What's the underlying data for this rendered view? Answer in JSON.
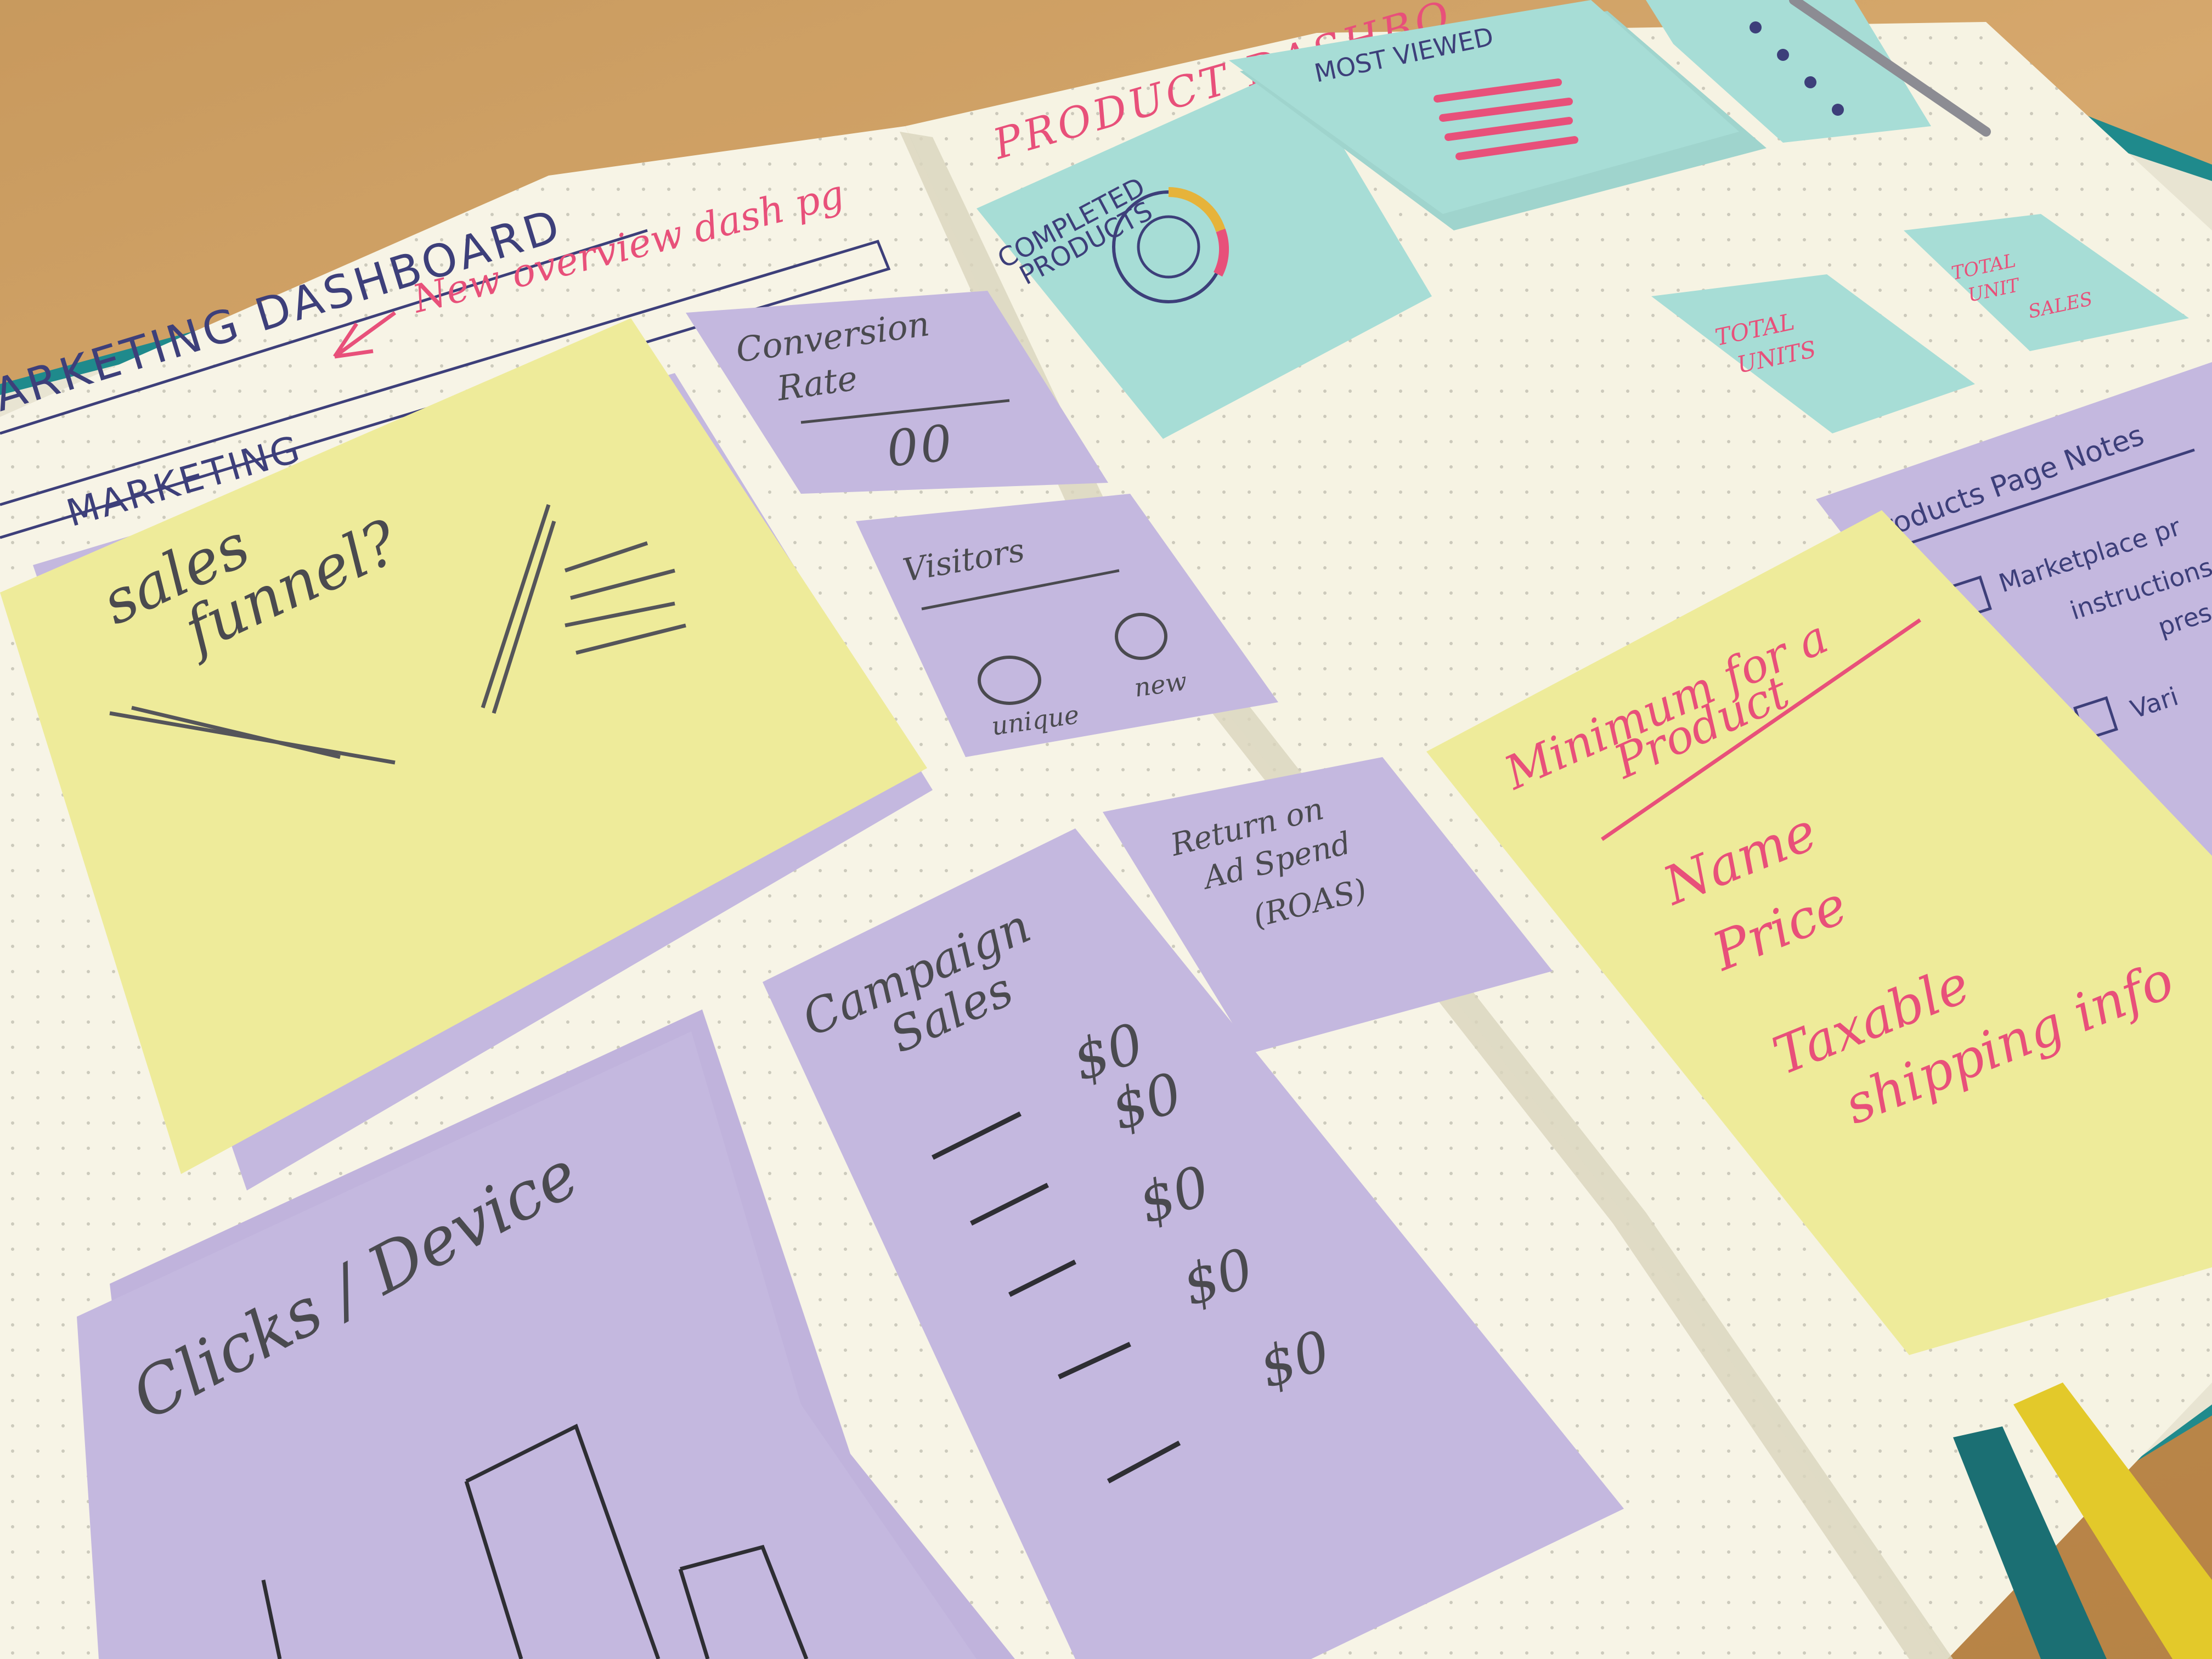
{
  "notebook": {
    "left_page": {
      "heading_title": "ARKETING DASHBOARD",
      "heading_annotation": "New overview dash pg",
      "heading_sub": "MARKETING"
    },
    "right_page": {
      "heading_title": "PRODUCT DASHBO"
    }
  },
  "notes": {
    "sales_funnel": {
      "title_line1": "sales",
      "title_line2": "funnel?"
    },
    "conversion_rate": {
      "title_line1": "Conversion",
      "title_line2": "Rate",
      "value": "00"
    },
    "visitors": {
      "title": "Visitors",
      "label_unique": "unique",
      "label_new": "new"
    },
    "return_on_ad_spend": {
      "line1": "Return on",
      "line2": "Ad Spend",
      "line3": "(ROAS)"
    },
    "campaign_sales": {
      "title_line1": "Campaign",
      "title_line2": "Sales",
      "values": [
        "$0",
        "$0",
        "$0",
        "$0",
        "$0"
      ]
    },
    "clicks_device": {
      "title": "Clicks / Device"
    },
    "completed_products": {
      "title_line1": "COMPLETED",
      "title_line2": "PRODUCTS"
    },
    "most_viewed": {
      "title": "MOST VIEWED"
    },
    "total_units": {
      "title_line1": "TOTAL",
      "title_line2": "UNITS"
    },
    "total_unit_sales": {
      "title_line1": "TOTAL",
      "title_line2": "UNIT",
      "title_line3": "SALES"
    },
    "minimum_product": {
      "title_line1": "Minimum for a",
      "title_line2": "Product",
      "items": [
        "Name",
        "Price",
        "Taxable",
        "shipping info"
      ]
    },
    "products_page_notes": {
      "title": "Products Page Notes",
      "item1_line1": "Marketplace pr",
      "item1_line2": "instructions",
      "item1_line3": "prese",
      "item2": "Vari"
    }
  },
  "colors": {
    "paper": "#f7f4e6",
    "lavender": "#c4b8df",
    "yellow": "#eeeb9a",
    "mint": "#a7ddd6",
    "pink_ink": "#e8507a",
    "pencil": "#4a4a4f",
    "navy_ink": "#3d3f7a",
    "notebook_cover": "#1f8a8c",
    "ribbon_yellow": "#e3c92a",
    "desk_wood": "#c89a5e"
  }
}
